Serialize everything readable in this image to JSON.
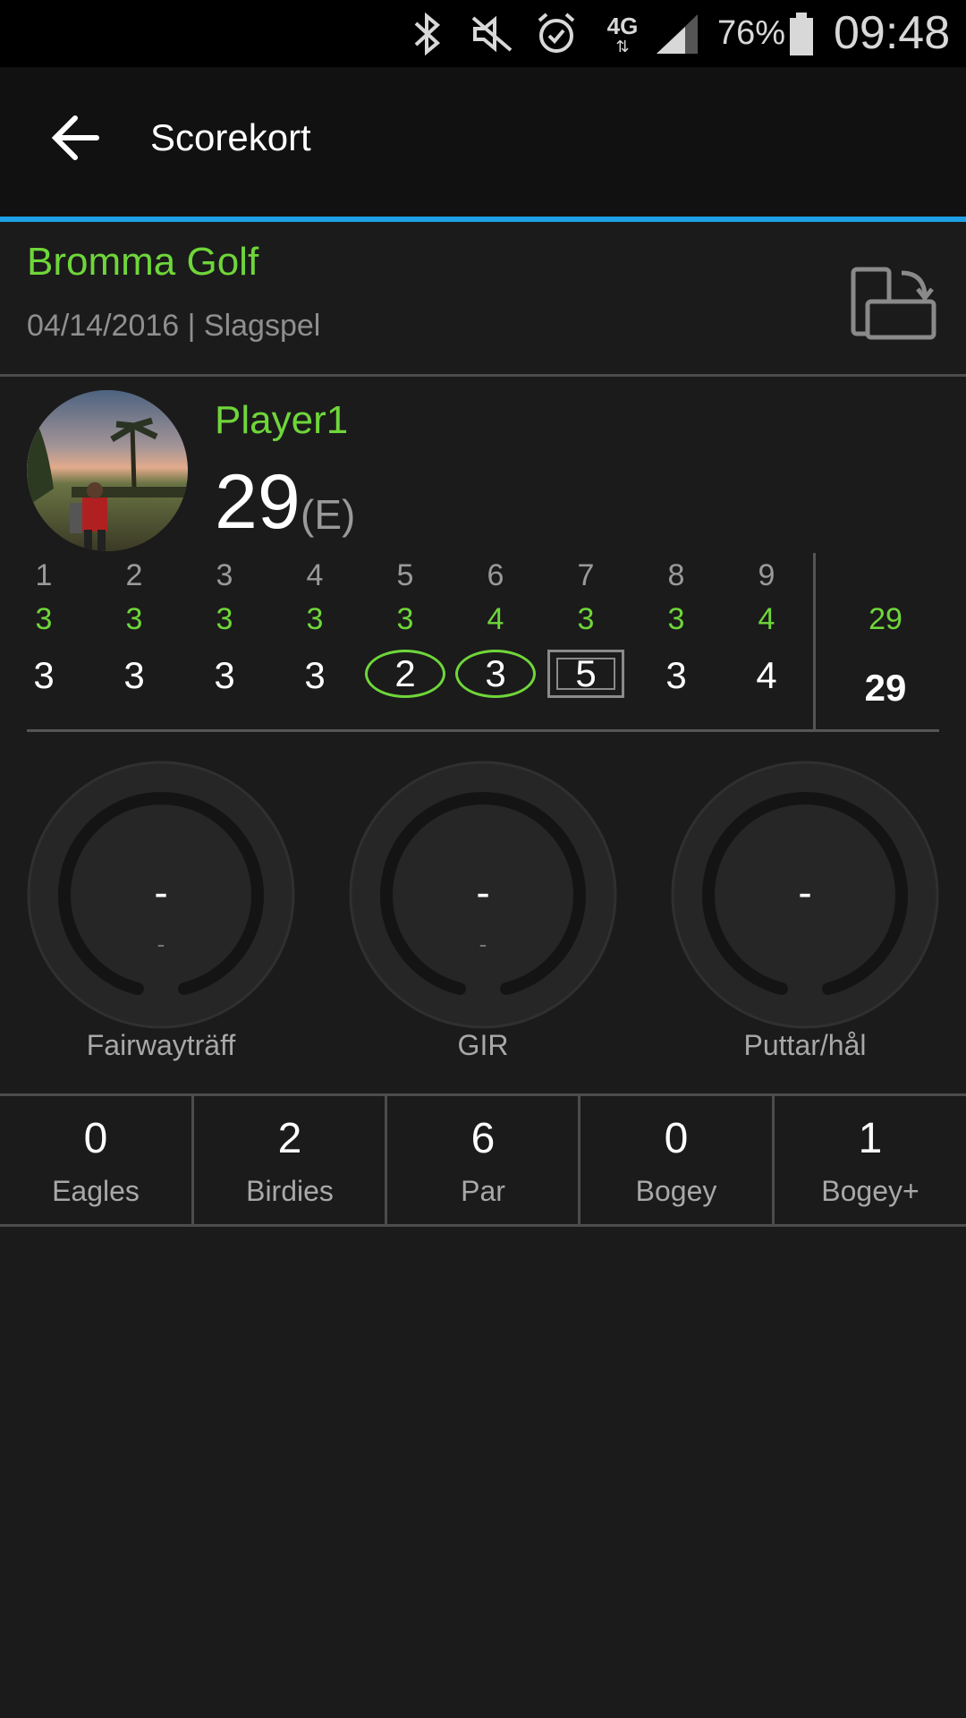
{
  "status_bar": {
    "icons": [
      "bluetooth-icon",
      "muted-icon",
      "alarm-icon",
      "network-4g-icon",
      "signal-icon",
      "battery-icon"
    ],
    "network": "4G",
    "battery": "76%",
    "time": "09:48"
  },
  "app_bar": {
    "title": "Scorekort",
    "back_icon": "arrow-left-icon",
    "accent": "#1e9fe6"
  },
  "course": {
    "name": "Bromma Golf",
    "subtitle": "04/14/2016 | Slagspel",
    "rotate_icon": "rotate-screen-icon"
  },
  "player": {
    "name": "Player1",
    "total": "29",
    "relative": "(E)"
  },
  "scorecard": {
    "holes": [
      "1",
      "2",
      "3",
      "4",
      "5",
      "6",
      "7",
      "8",
      "9"
    ],
    "pars": [
      "3",
      "3",
      "3",
      "3",
      "3",
      "4",
      "3",
      "3",
      "4"
    ],
    "scores": [
      "3",
      "3",
      "3",
      "3",
      "2",
      "3",
      "5",
      "3",
      "4"
    ],
    "score_marks": [
      "none",
      "none",
      "none",
      "none",
      "circle",
      "circle",
      "square",
      "none",
      "none"
    ],
    "total_par": "29",
    "total_score": "29"
  },
  "gauges": [
    {
      "value": "-",
      "sub": "-",
      "label": "Fairwayträff"
    },
    {
      "value": "-",
      "sub": "-",
      "label": "GIR"
    },
    {
      "value": "-",
      "sub": "",
      "label": "Puttar/hål"
    }
  ],
  "stats": [
    {
      "count": "0",
      "label": "Eagles"
    },
    {
      "count": "2",
      "label": "Birdies"
    },
    {
      "count": "6",
      "label": "Par"
    },
    {
      "count": "0",
      "label": "Bogey"
    },
    {
      "count": "1",
      "label": "Bogey+"
    }
  ],
  "colors": {
    "green": "#6fd63a",
    "background": "#1b1b1b"
  }
}
